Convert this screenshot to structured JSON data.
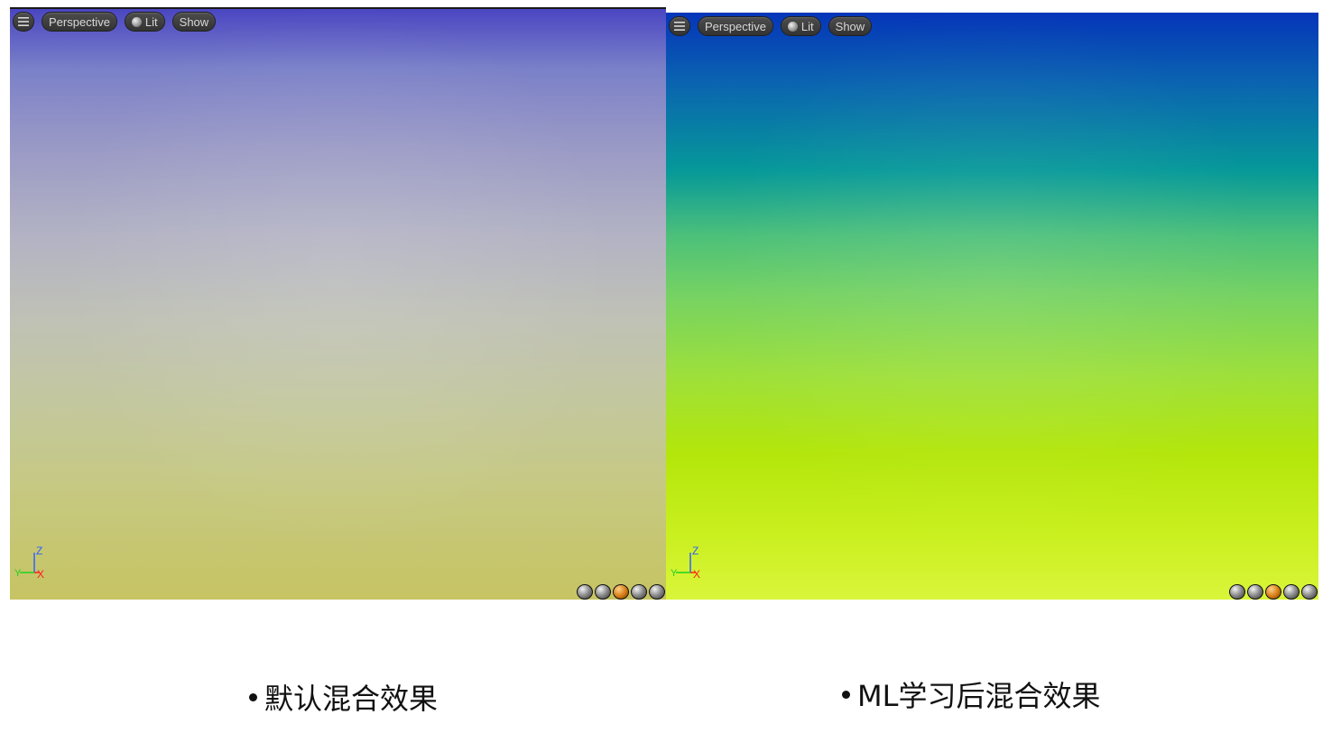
{
  "left_viewport": {
    "toolbar": {
      "perspective_label": "Perspective",
      "lit_label": "Lit",
      "show_label": "Show"
    },
    "axis": {
      "z": "Z",
      "y": "Y",
      "x": "X"
    }
  },
  "right_viewport": {
    "toolbar": {
      "perspective_label": "Perspective",
      "lit_label": "Lit",
      "show_label": "Show"
    },
    "axis": {
      "z": "Z",
      "y": "Y",
      "x": "X"
    }
  },
  "captions": {
    "left": "默认混合效果",
    "right": "ML学习后混合效果"
  },
  "colors": {
    "left_top": "#4a46c2",
    "left_bottom": "#c6c462",
    "right_top": "#0535b9",
    "right_mid": "#069999",
    "right_bottom": "#daf53a",
    "axis_x": "#ff2020",
    "axis_y": "#20d020",
    "axis_z": "#3060ff"
  }
}
